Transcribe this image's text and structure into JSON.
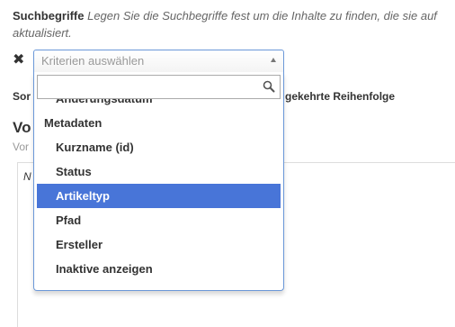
{
  "help": {
    "label": "Suchbegriffe",
    "text": "Legen Sie die Suchbegriffe fest um die Inhalte zu finden, die sie auf",
    "text_cont": "aktualisiert."
  },
  "criteria": {
    "remove_label": "✖",
    "placeholder": "Kriterien auswählen"
  },
  "background": {
    "sort_label_fragment": "Sor",
    "sort_order_fragment": "gekehrte Reihenfolge",
    "heading_fragment": "Vo",
    "sub_fragment": "Vor",
    "panel_text_fragment": "N"
  },
  "dropdown": {
    "search_value": "",
    "items": [
      {
        "label": "Änderungsdatum",
        "group": false
      },
      {
        "label": "Metadaten",
        "group": true
      },
      {
        "label": "Kurzname (id)",
        "group": false
      },
      {
        "label": "Status",
        "group": false
      },
      {
        "label": "Artikeltyp",
        "group": false,
        "highlighted": true
      },
      {
        "label": "Pfad",
        "group": false
      },
      {
        "label": "Ersteller",
        "group": false
      },
      {
        "label": "Inaktive anzeigen",
        "group": false
      }
    ]
  },
  "colors": {
    "highlight": "#4875d8",
    "focus_border": "#6b98d8"
  }
}
